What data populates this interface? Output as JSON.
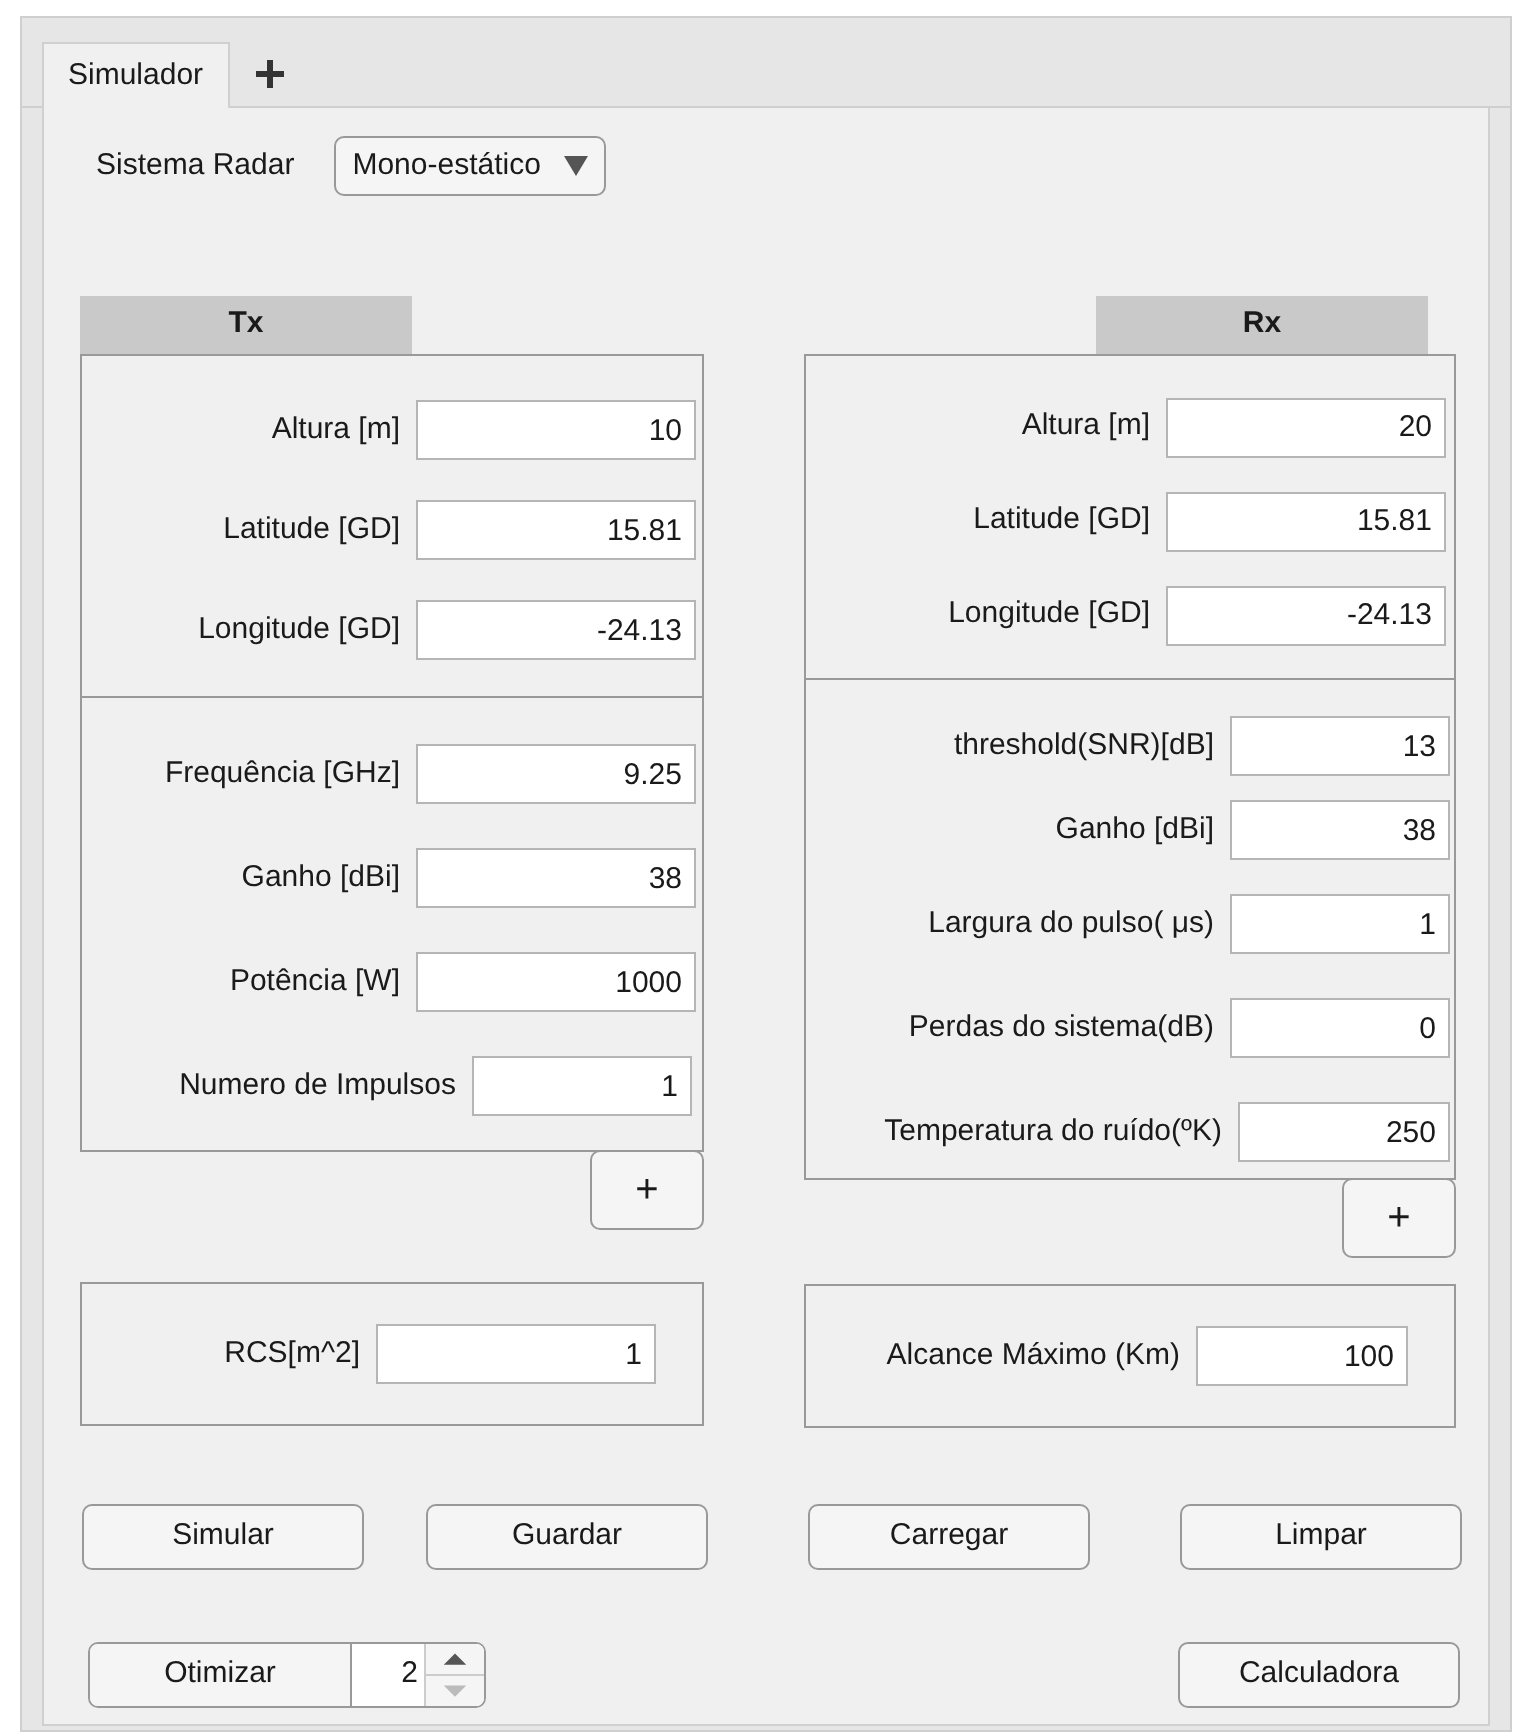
{
  "tabs": [
    {
      "label": "Simulador",
      "selected": true
    }
  ],
  "system": {
    "label": "Sistema Radar",
    "value": "Mono-estático"
  },
  "tx": {
    "title": "Tx",
    "sections": [
      [
        {
          "label": "Altura [m]",
          "value": "10"
        },
        {
          "label": "Latitude [GD]",
          "value": "15.81"
        },
        {
          "label": "Longitude [GD]",
          "value": "-24.13"
        }
      ],
      [
        {
          "label": "Frequência [GHz]",
          "value": "9.25"
        },
        {
          "label": "Ganho [dBi]",
          "value": "38"
        },
        {
          "label": "Potência [W]",
          "value": "1000"
        },
        {
          "label": "Numero de Impulsos",
          "value": "1"
        }
      ]
    ],
    "add_button": "+"
  },
  "rx": {
    "title": "Rx",
    "sections": [
      [
        {
          "label": "Altura [m]",
          "value": "20"
        },
        {
          "label": "Latitude [GD]",
          "value": "15.81"
        },
        {
          "label": "Longitude [GD]",
          "value": "-24.13"
        }
      ],
      [
        {
          "label": "threshold(SNR)[dB]",
          "value": "13"
        },
        {
          "label": "Ganho [dBi]",
          "value": "38"
        },
        {
          "label": "Largura do pulso( μs)",
          "value": "1"
        },
        {
          "label": "Perdas do sistema(dB)",
          "value": "0"
        },
        {
          "label": "Temperatura do ruído(ºK)",
          "value": "250"
        }
      ]
    ],
    "add_button": "+"
  },
  "rcs": {
    "label": "RCS[m^2]",
    "value": "1"
  },
  "max_range": {
    "label": "Alcance Máximo (Km)",
    "value": "100"
  },
  "buttons": [
    "Simular",
    "Guardar",
    "Carregar",
    "Limpar"
  ],
  "optimize": {
    "label": "Otimizar",
    "value": "2"
  },
  "calculator": "Calculadora"
}
